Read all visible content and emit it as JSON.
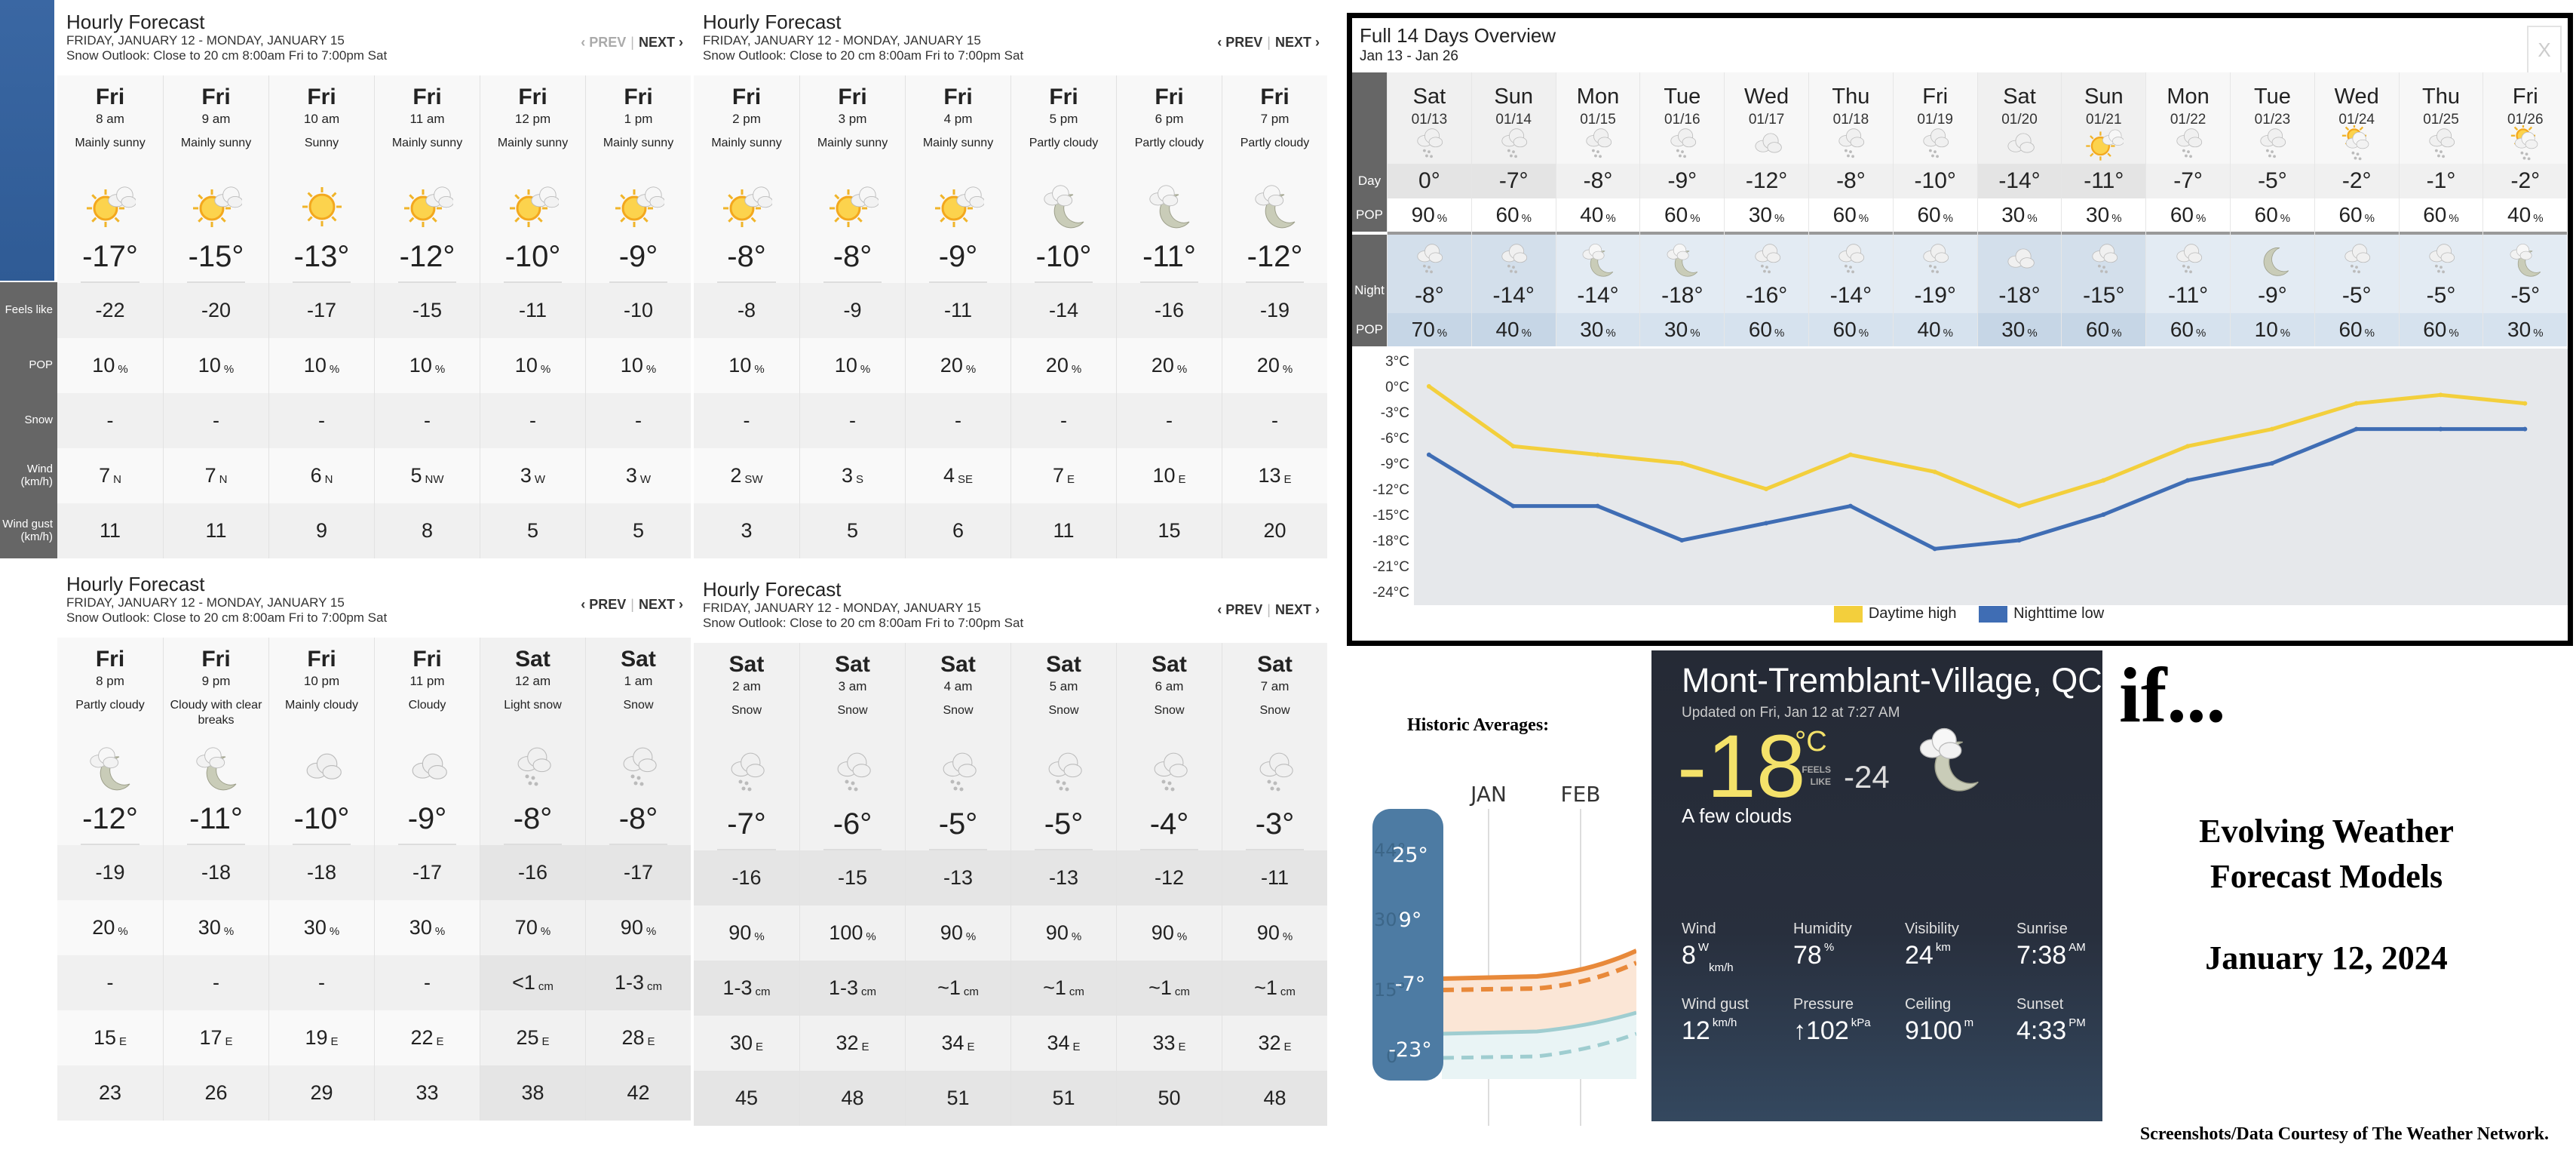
{
  "hourly_labels": [
    "Feels like",
    "POP",
    "Snow",
    "Wind (km/h)",
    "Wind gust (km/h)"
  ],
  "panels": [
    {
      "title": "Hourly Forecast",
      "dates": "FRIDAY, JANUARY 12 - MONDAY, JANUARY 15",
      "snow_outlook": "Snow Outlook: Close to 20 cm 8:00am Fri to 7:00pm Sat",
      "prev": "‹ PREV",
      "next": "NEXT ›",
      "prev_disabled": true,
      "cols": [
        {
          "day": "Fri",
          "time": "8 am",
          "cond": "Mainly sunny",
          "icon": "sun-cloud",
          "temp": "-17°",
          "feels": "-22",
          "pop": "10",
          "snow": "-",
          "wind": "7",
          "dir": "N",
          "gust": "11",
          "shade": false
        },
        {
          "day": "Fri",
          "time": "9 am",
          "cond": "Mainly sunny",
          "icon": "sun-cloud",
          "temp": "-15°",
          "feels": "-20",
          "pop": "10",
          "snow": "-",
          "wind": "7",
          "dir": "N",
          "gust": "11",
          "shade": false
        },
        {
          "day": "Fri",
          "time": "10 am",
          "cond": "Sunny",
          "icon": "sun",
          "temp": "-13°",
          "feels": "-17",
          "pop": "10",
          "snow": "-",
          "wind": "6",
          "dir": "N",
          "gust": "9",
          "shade": false
        },
        {
          "day": "Fri",
          "time": "11 am",
          "cond": "Mainly sunny",
          "icon": "sun-cloud",
          "temp": "-12°",
          "feels": "-15",
          "pop": "10",
          "snow": "-",
          "wind": "5",
          "dir": "NW",
          "gust": "8",
          "shade": false
        },
        {
          "day": "Fri",
          "time": "12 pm",
          "cond": "Mainly sunny",
          "icon": "sun-cloud",
          "temp": "-10°",
          "feels": "-11",
          "pop": "10",
          "snow": "-",
          "wind": "3",
          "dir": "W",
          "gust": "5",
          "shade": false
        },
        {
          "day": "Fri",
          "time": "1 pm",
          "cond": "Mainly sunny",
          "icon": "sun-cloud",
          "temp": "-9°",
          "feels": "-10",
          "pop": "10",
          "snow": "-",
          "wind": "3",
          "dir": "W",
          "gust": "5",
          "shade": false
        }
      ]
    },
    {
      "title": "Hourly Forecast",
      "dates": "FRIDAY, JANUARY 12 - MONDAY, JANUARY 15",
      "snow_outlook": "Snow Outlook: Close to 20 cm 8:00am Fri to 7:00pm Sat",
      "prev": "‹ PREV",
      "next": "NEXT ›",
      "prev_disabled": false,
      "cols": [
        {
          "day": "Fri",
          "time": "2 pm",
          "cond": "Mainly sunny",
          "icon": "sun-cloud",
          "temp": "-8°",
          "feels": "-8",
          "pop": "10",
          "snow": "-",
          "wind": "2",
          "dir": "SW",
          "gust": "3",
          "shade": false
        },
        {
          "day": "Fri",
          "time": "3 pm",
          "cond": "Mainly sunny",
          "icon": "sun-cloud",
          "temp": "-8°",
          "feels": "-9",
          "pop": "10",
          "snow": "-",
          "wind": "3",
          "dir": "S",
          "gust": "5",
          "shade": false
        },
        {
          "day": "Fri",
          "time": "4 pm",
          "cond": "Mainly sunny",
          "icon": "sun-cloud",
          "temp": "-9°",
          "feels": "-11",
          "pop": "20",
          "snow": "-",
          "wind": "4",
          "dir": "SE",
          "gust": "6",
          "shade": false
        },
        {
          "day": "Fri",
          "time": "5 pm",
          "cond": "Partly cloudy",
          "icon": "moon-cloud",
          "temp": "-10°",
          "feels": "-14",
          "pop": "20",
          "snow": "-",
          "wind": "7",
          "dir": "E",
          "gust": "11",
          "shade": false
        },
        {
          "day": "Fri",
          "time": "6 pm",
          "cond": "Partly cloudy",
          "icon": "moon-cloud",
          "temp": "-11°",
          "feels": "-16",
          "pop": "20",
          "snow": "-",
          "wind": "10",
          "dir": "E",
          "gust": "15",
          "shade": false
        },
        {
          "day": "Fri",
          "time": "7 pm",
          "cond": "Partly cloudy",
          "icon": "moon-cloud",
          "temp": "-12°",
          "feels": "-19",
          "pop": "20",
          "snow": "-",
          "wind": "13",
          "dir": "E",
          "gust": "20",
          "shade": false
        }
      ]
    },
    {
      "title": "Hourly Forecast",
      "dates": "FRIDAY, JANUARY 12 - MONDAY, JANUARY 15",
      "snow_outlook": "Snow Outlook: Close to 20 cm 8:00am Fri to 7:00pm Sat",
      "prev": "‹ PREV",
      "next": "NEXT ›",
      "prev_disabled": false,
      "cols": [
        {
          "day": "Fri",
          "time": "8 pm",
          "cond": "Partly cloudy",
          "icon": "moon-cloud",
          "temp": "-12°",
          "feels": "-19",
          "pop": "20",
          "snow": "-",
          "wind": "15",
          "dir": "E",
          "gust": "23",
          "shade": false
        },
        {
          "day": "Fri",
          "time": "9 pm",
          "cond": "Cloudy with clear breaks",
          "icon": "moon-cloud",
          "temp": "-11°",
          "feels": "-18",
          "pop": "30",
          "snow": "-",
          "wind": "17",
          "dir": "E",
          "gust": "26",
          "shade": false
        },
        {
          "day": "Fri",
          "time": "10 pm",
          "cond": "Mainly cloudy",
          "icon": "cloud",
          "temp": "-10°",
          "feels": "-18",
          "pop": "30",
          "snow": "-",
          "wind": "19",
          "dir": "E",
          "gust": "29",
          "shade": false
        },
        {
          "day": "Fri",
          "time": "11 pm",
          "cond": "Cloudy",
          "icon": "cloud",
          "temp": "-9°",
          "feels": "-17",
          "pop": "30",
          "snow": "-",
          "wind": "22",
          "dir": "E",
          "gust": "33",
          "shade": false
        },
        {
          "day": "Sat",
          "time": "12 am",
          "cond": "Light snow",
          "icon": "snow",
          "temp": "-8°",
          "feels": "-16",
          "pop": "70",
          "snow": "<1",
          "snow_unit": "cm",
          "wind": "25",
          "dir": "E",
          "gust": "38",
          "shade": true
        },
        {
          "day": "Sat",
          "time": "1 am",
          "cond": "Snow",
          "icon": "snow",
          "temp": "-8°",
          "feels": "-17",
          "pop": "90",
          "snow": "1-3",
          "snow_unit": "cm",
          "wind": "28",
          "dir": "E",
          "gust": "42",
          "shade": true
        }
      ]
    },
    {
      "title": "Hourly Forecast",
      "dates": "FRIDAY, JANUARY 12 - MONDAY, JANUARY 15",
      "snow_outlook": "Snow Outlook: Close to 20 cm 8:00am Fri to 7:00pm Sat",
      "prev": "‹ PREV",
      "next": "NEXT ›",
      "prev_disabled": false,
      "cols": [
        {
          "day": "Sat",
          "time": "2 am",
          "cond": "Snow",
          "icon": "snow",
          "temp": "-7°",
          "feels": "-16",
          "pop": "90",
          "snow": "1-3",
          "snow_unit": "cm",
          "wind": "30",
          "dir": "E",
          "gust": "45",
          "shade": true
        },
        {
          "day": "Sat",
          "time": "3 am",
          "cond": "Snow",
          "icon": "snow",
          "temp": "-6°",
          "feels": "-15",
          "pop": "100",
          "snow": "1-3",
          "snow_unit": "cm",
          "wind": "32",
          "dir": "E",
          "gust": "48",
          "shade": true
        },
        {
          "day": "Sat",
          "time": "4 am",
          "cond": "Snow",
          "icon": "snow",
          "temp": "-5°",
          "feels": "-13",
          "pop": "90",
          "snow": "~1",
          "snow_unit": "cm",
          "wind": "34",
          "dir": "E",
          "gust": "51",
          "shade": true
        },
        {
          "day": "Sat",
          "time": "5 am",
          "cond": "Snow",
          "icon": "snow",
          "temp": "-5°",
          "feels": "-13",
          "pop": "90",
          "snow": "~1",
          "snow_unit": "cm",
          "wind": "34",
          "dir": "E",
          "gust": "51",
          "shade": true
        },
        {
          "day": "Sat",
          "time": "6 am",
          "cond": "Snow",
          "icon": "snow",
          "temp": "-4°",
          "feels": "-12",
          "pop": "90",
          "snow": "~1",
          "snow_unit": "cm",
          "wind": "33",
          "dir": "E",
          "gust": "50",
          "shade": true
        },
        {
          "day": "Sat",
          "time": "7 am",
          "cond": "Snow",
          "icon": "snow",
          "temp": "-3°",
          "feels": "-11",
          "pop": "90",
          "snow": "~1",
          "snow_unit": "cm",
          "wind": "32",
          "dir": "E",
          "gust": "48",
          "shade": true
        }
      ]
    }
  ],
  "overview": {
    "title": "Full 14 Days Overview",
    "range": "Jan 13 - Jan 26",
    "close": "X",
    "labels": {
      "day": "Day",
      "pop": "POP",
      "night": "Night"
    },
    "pop_unit": "%",
    "days": [
      {
        "name": "Sat",
        "date": "01/13",
        "dicon": "snow",
        "day": "0°",
        "dpop": "90",
        "nicon": "snow",
        "night": "-8°",
        "npop": "70",
        "we": true
      },
      {
        "name": "Sun",
        "date": "01/14",
        "dicon": "snow",
        "day": "-7°",
        "dpop": "60",
        "nicon": "snow",
        "night": "-14°",
        "npop": "40",
        "we": true
      },
      {
        "name": "Mon",
        "date": "01/15",
        "dicon": "snow",
        "day": "-8°",
        "dpop": "40",
        "nicon": "moon-cloud",
        "night": "-14°",
        "npop": "30",
        "we": false
      },
      {
        "name": "Tue",
        "date": "01/16",
        "dicon": "snow",
        "day": "-9°",
        "dpop": "60",
        "nicon": "moon-cloud",
        "night": "-18°",
        "npop": "30",
        "we": false
      },
      {
        "name": "Wed",
        "date": "01/17",
        "dicon": "cloud",
        "day": "-12°",
        "dpop": "30",
        "nicon": "snow",
        "night": "-16°",
        "npop": "60",
        "we": false
      },
      {
        "name": "Thu",
        "date": "01/18",
        "dicon": "snow",
        "day": "-8°",
        "dpop": "60",
        "nicon": "snow",
        "night": "-14°",
        "npop": "60",
        "we": false
      },
      {
        "name": "Fri",
        "date": "01/19",
        "dicon": "snow",
        "day": "-10°",
        "dpop": "60",
        "nicon": "snow",
        "night": "-19°",
        "npop": "40",
        "we": false
      },
      {
        "name": "Sat",
        "date": "01/20",
        "dicon": "cloud",
        "day": "-14°",
        "dpop": "30",
        "nicon": "cloud",
        "night": "-18°",
        "npop": "30",
        "we": true
      },
      {
        "name": "Sun",
        "date": "01/21",
        "dicon": "sun-cloud",
        "day": "-11°",
        "dpop": "30",
        "nicon": "snow",
        "night": "-15°",
        "npop": "60",
        "we": true
      },
      {
        "name": "Mon",
        "date": "01/22",
        "dicon": "snow",
        "day": "-7°",
        "dpop": "60",
        "nicon": "snow",
        "night": "-11°",
        "npop": "60",
        "we": false
      },
      {
        "name": "Tue",
        "date": "01/23",
        "dicon": "snow",
        "day": "-5°",
        "dpop": "60",
        "nicon": "moon",
        "night": "-9°",
        "npop": "10",
        "we": false
      },
      {
        "name": "Wed",
        "date": "01/24",
        "dicon": "sun-cloud-snow",
        "day": "-2°",
        "dpop": "60",
        "nicon": "snow",
        "night": "-5°",
        "npop": "60",
        "we": false
      },
      {
        "name": "Thu",
        "date": "01/25",
        "dicon": "snow",
        "day": "-1°",
        "dpop": "60",
        "nicon": "snow",
        "night": "-5°",
        "npop": "60",
        "we": false
      },
      {
        "name": "Fri",
        "date": "01/26",
        "dicon": "sun-cloud-snow",
        "day": "-2°",
        "dpop": "40",
        "nicon": "moon-cloud",
        "night": "-5°",
        "npop": "30",
        "we": false
      }
    ]
  },
  "chart_data": {
    "type": "line",
    "categories": [
      "01/13",
      "01/14",
      "01/15",
      "01/16",
      "01/17",
      "01/18",
      "01/19",
      "01/20",
      "01/21",
      "01/22",
      "01/23",
      "01/24",
      "01/25",
      "01/26"
    ],
    "series": [
      {
        "name": "Daytime high",
        "color": "#f3cf3c",
        "values": [
          0,
          -7,
          -8,
          -9,
          -12,
          -8,
          -10,
          -14,
          -11,
          -7,
          -5,
          -2,
          -1,
          -2
        ]
      },
      {
        "name": "Nighttime low",
        "color": "#3f6db4",
        "values": [
          -8,
          -14,
          -14,
          -18,
          -16,
          -14,
          -19,
          -18,
          -15,
          -11,
          -9,
          -5,
          -5,
          -5
        ]
      }
    ],
    "yticks": [
      "3°C",
      "0°C",
      "-3°C",
      "-6°C",
      "-9°C",
      "-12°C",
      "-15°C",
      "-18°C",
      "-21°C",
      "-24°C"
    ],
    "ylim": [
      -24,
      3
    ],
    "legend": "bottom",
    "grid": false
  },
  "historic": {
    "title": "Historic Averages:",
    "months": [
      "JAN",
      "FEB"
    ],
    "scale": [
      "25°",
      "9°",
      "-7°",
      "-23°"
    ],
    "ghost_scale": [
      "44°",
      "30°",
      "15°",
      "0"
    ],
    "colors": {
      "high": "#e8893a",
      "low": "#9fcdd0",
      "bar": "#4d7ba3"
    }
  },
  "current": {
    "location": "Mont-Tremblant-Village, QC",
    "updated": "Updated on Fri, Jan 12 at 7:27 AM",
    "temp": "-18",
    "unit": "°C",
    "feels_label": "FEELS LIKE",
    "feels": "-24",
    "condition": "A few clouds",
    "icon": "moon-cloud",
    "details": [
      {
        "label": "Wind",
        "value": "8",
        "sup": "W",
        "sub": "km/h"
      },
      {
        "label": "Humidity",
        "value": "78",
        "sup": "%"
      },
      {
        "label": "Visibility",
        "value": "24",
        "sup": "km"
      },
      {
        "label": "Sunrise",
        "value": "7:38",
        "sup": "AM"
      },
      {
        "label": "Wind gust",
        "value": "12",
        "sup": "km/h"
      },
      {
        "label": "Pressure",
        "value": "↑102",
        "sup": "kPa"
      },
      {
        "label": "Ceiling",
        "value": "9100",
        "sup": "m"
      },
      {
        "label": "Sunset",
        "value": "4:33",
        "sup": "PM"
      }
    ]
  },
  "caption": {
    "if": "if...",
    "line1": "Evolving Weather",
    "line2": "Forecast Models",
    "date": "January 12, 2024",
    "credit": "Screenshots/Data Courtesy of The Weather Network."
  }
}
